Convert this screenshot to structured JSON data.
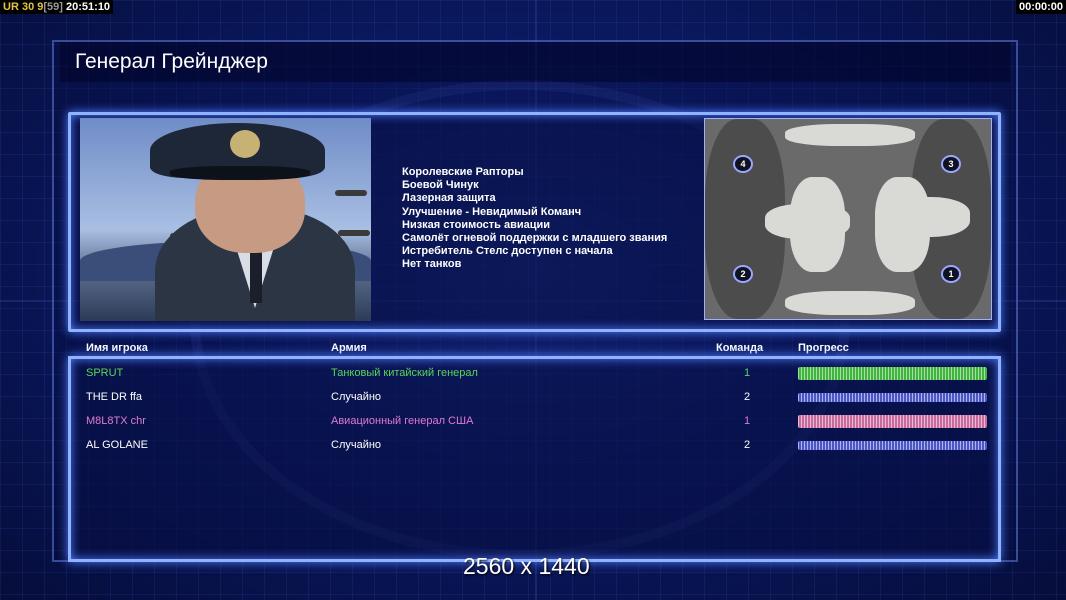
{
  "hud": {
    "left_prefix": "UR",
    "left_a": "30",
    "left_b": "9",
    "left_c": "[59]",
    "clock": "20:51:10",
    "timer": "00:00:00"
  },
  "title": "Генерал Грейнджер",
  "perks": [
    "Королевские Рапторы",
    "Боевой Чинук",
    "Лазерная защита",
    "Улучшение - Невидимый Команч",
    "Низкая стоимость авиации",
    "Самолёт огневой поддержки с младшего звания",
    "Истребитель Стелс доступен с начала",
    "Нет танков"
  ],
  "map": {
    "spawns": [
      "1",
      "2",
      "3",
      "4"
    ]
  },
  "table": {
    "headers": {
      "player": "Имя игрока",
      "army": "Армия",
      "team": "Команда",
      "progress": "Прогресс"
    },
    "rows": [
      {
        "player": "SPRUT",
        "army": "Танковый китайский генерал",
        "team": "1",
        "color": "#59d659",
        "progress": 1.0
      },
      {
        "player": "THE DR ffa",
        "army": "Случайно",
        "team": "2",
        "color": "#ffffff",
        "progress": 1.0
      },
      {
        "player": "M8L8TX chr",
        "army": "Авиационный генерал США",
        "team": "1",
        "color": "#e07ad0",
        "progress": 1.0
      },
      {
        "player": "AL GOLANE",
        "army": "Случайно",
        "team": "2",
        "color": "#ffffff",
        "progress": 1.0
      }
    ]
  },
  "watermark": "2560 x 1440"
}
